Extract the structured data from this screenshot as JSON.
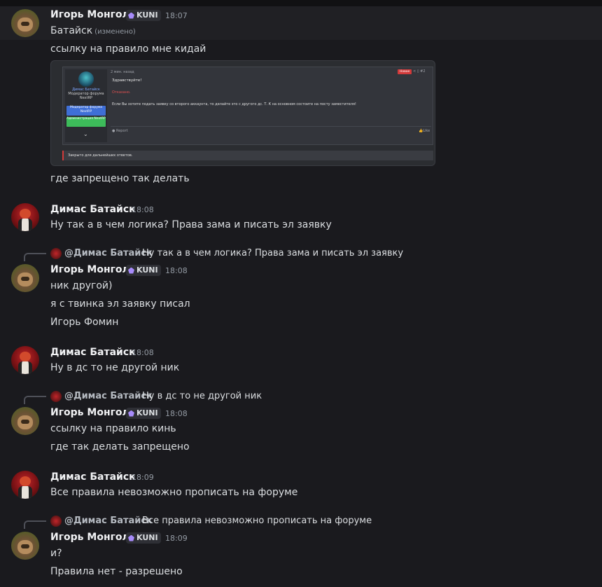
{
  "users": {
    "igor": {
      "name": "Игорь Монгол",
      "tag": "KUNI",
      "tag_icon": "gem-icon"
    },
    "dimas": {
      "name": "Димас Батайск"
    }
  },
  "messages": [
    {
      "author": "Игорь Монгол",
      "tag": "KUNI",
      "time": "18:07",
      "lines": [
        "Батайск",
        "ссылку на правило мне кидай"
      ],
      "edited": "(изменено)"
    },
    {
      "author": "Игорь Монгол",
      "line_after_image": "где запрещено так делать"
    },
    {
      "author": "Димас Батайск",
      "time": "18:08",
      "lines": [
        "Ну так а в чем логика? Права зама и писать эл заявку"
      ]
    },
    {
      "reply_to": "@Димас Батайск",
      "reply_text": "Ну так а в чем логика? Права зама и писать эл заявку",
      "author": "Игорь Монгол",
      "tag": "KUNI",
      "time": "18:08",
      "lines": [
        "ник другой)",
        "я с твинка эл заявку писал",
        "Игорь Фомин"
      ]
    },
    {
      "author": "Димас Батайск",
      "time": "18:08",
      "lines": [
        "Ну в дс то не другой ник"
      ]
    },
    {
      "reply_to": "@Димас Батайск",
      "reply_text": "Ну в дс то не другой ник",
      "author": "Игорь Монгол",
      "tag": "KUNI",
      "time": "18:08",
      "lines": [
        "ссылку на правило кинь",
        "где так делать запрещено"
      ]
    },
    {
      "author": "Димас Батайск",
      "time": "18:09",
      "lines": [
        "Все правила невозможно прописать на форуме"
      ]
    },
    {
      "reply_to": "@Димас Батайск",
      "reply_text": "Все правила невозможно прописать на форуме",
      "author": "Игорь Монгол",
      "tag": "KUNI",
      "time": "18:09",
      "lines": [
        "и?",
        "Правила нет - разрешено"
      ]
    }
  ],
  "embed": {
    "user_name": "Димас Батайск",
    "user_role": "Модератор форума NextRP",
    "badge_blue": "Модератор форума NextRP",
    "badge_green": "Администрация NextRP",
    "post_time": "2 мин. назад",
    "new_label": "Новое",
    "post_number": "#2",
    "greeting": "Здравствуйте!",
    "status": "Отказано.",
    "body": "Если Вы хотите подать заявку со второго аккаунта, то делайте это с другого дс. Т. К на основном состоите на посту заместителя!",
    "report": "Report",
    "like": "Like",
    "closed": "Закрыто для дальнейших ответов."
  },
  "colors": {
    "background": "#1a1a1e",
    "accent_tag": "#a78bfa",
    "new_badge": "#d23a3a"
  }
}
